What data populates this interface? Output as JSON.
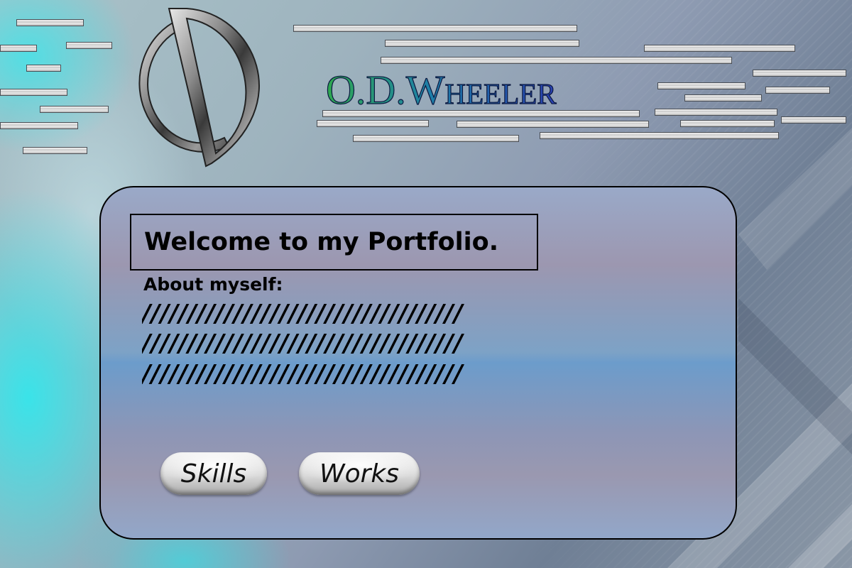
{
  "brand": {
    "name": "O.D.Wheeler",
    "logo_icon": "od-monogram-icon",
    "gradient": [
      "#2fa84f",
      "#1e7fa8",
      "#2a3fb0"
    ]
  },
  "welcome": {
    "heading": "Welcome to my Portfolio."
  },
  "about": {
    "label": "About myself:",
    "lines": [
      "///////////////////////////////////",
      "///////////////////////////////////",
      "///////////////////////////////////"
    ]
  },
  "nav": {
    "skills_label": "Skills",
    "works_label": "Works"
  },
  "colors": {
    "accent_cyan": "#2ee8ee",
    "panel_border": "#000000"
  }
}
